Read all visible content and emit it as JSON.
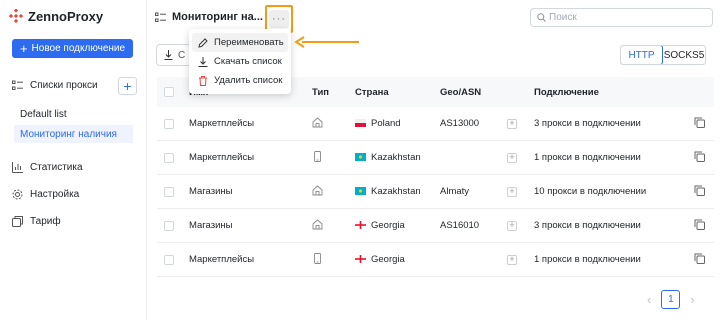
{
  "app": {
    "logo_text": "ZennoProxy",
    "brand_color": "#2d6bf0"
  },
  "sidebar": {
    "new_button": "Новое подключение",
    "proxy_lists_label": "Списки прокси",
    "lists": [
      {
        "label": "Default list",
        "active": false
      },
      {
        "label": "Мониторинг наличия",
        "active": true
      }
    ],
    "items": [
      {
        "label": "Статистика",
        "icon": "chart-icon"
      },
      {
        "label": "Настройка",
        "icon": "gear-icon"
      },
      {
        "label": "Тариф",
        "icon": "wallet-icon"
      }
    ]
  },
  "header": {
    "title": "Мониторинг на...",
    "more_label": "···",
    "search_placeholder": "Поиск"
  },
  "toolbar": {
    "download_label": "С",
    "protocols": [
      "HTTP",
      "SOCKS5"
    ],
    "active_protocol": "HTTP"
  },
  "context_menu": {
    "items": [
      {
        "label": "Переименовать",
        "icon": "pencil-icon"
      },
      {
        "label": "Скачать список",
        "icon": "download-icon"
      },
      {
        "label": "Удалить список",
        "icon": "trash-icon"
      }
    ]
  },
  "table": {
    "columns": [
      "Имя",
      "Тип",
      "Страна",
      "Geo/ASN",
      "Подключение"
    ],
    "rows": [
      {
        "name": "Маркетплейсы",
        "type": "home-icon",
        "country": "Poland",
        "geo": "AS13000",
        "connection": "3 прокси в подключении"
      },
      {
        "name": "Маркетплейсы",
        "type": "phone-icon",
        "country": "Kazakhstan",
        "geo": "",
        "connection": "1 прокси в подключении"
      },
      {
        "name": "Магазины",
        "type": "home-icon",
        "country": "Kazakhstan",
        "geo": "Almaty",
        "connection": "10 прокси в подключении"
      },
      {
        "name": "Магазины",
        "type": "home-icon",
        "country": "Georgia",
        "geo": "AS16010",
        "connection": "3 прокси в подключении"
      },
      {
        "name": "Маркетплейсы",
        "type": "phone-icon",
        "country": "Georgia",
        "geo": "",
        "connection": "1 прокси в подключении"
      }
    ]
  },
  "pagination": {
    "current": "1",
    "prev": "‹",
    "next": "›"
  }
}
